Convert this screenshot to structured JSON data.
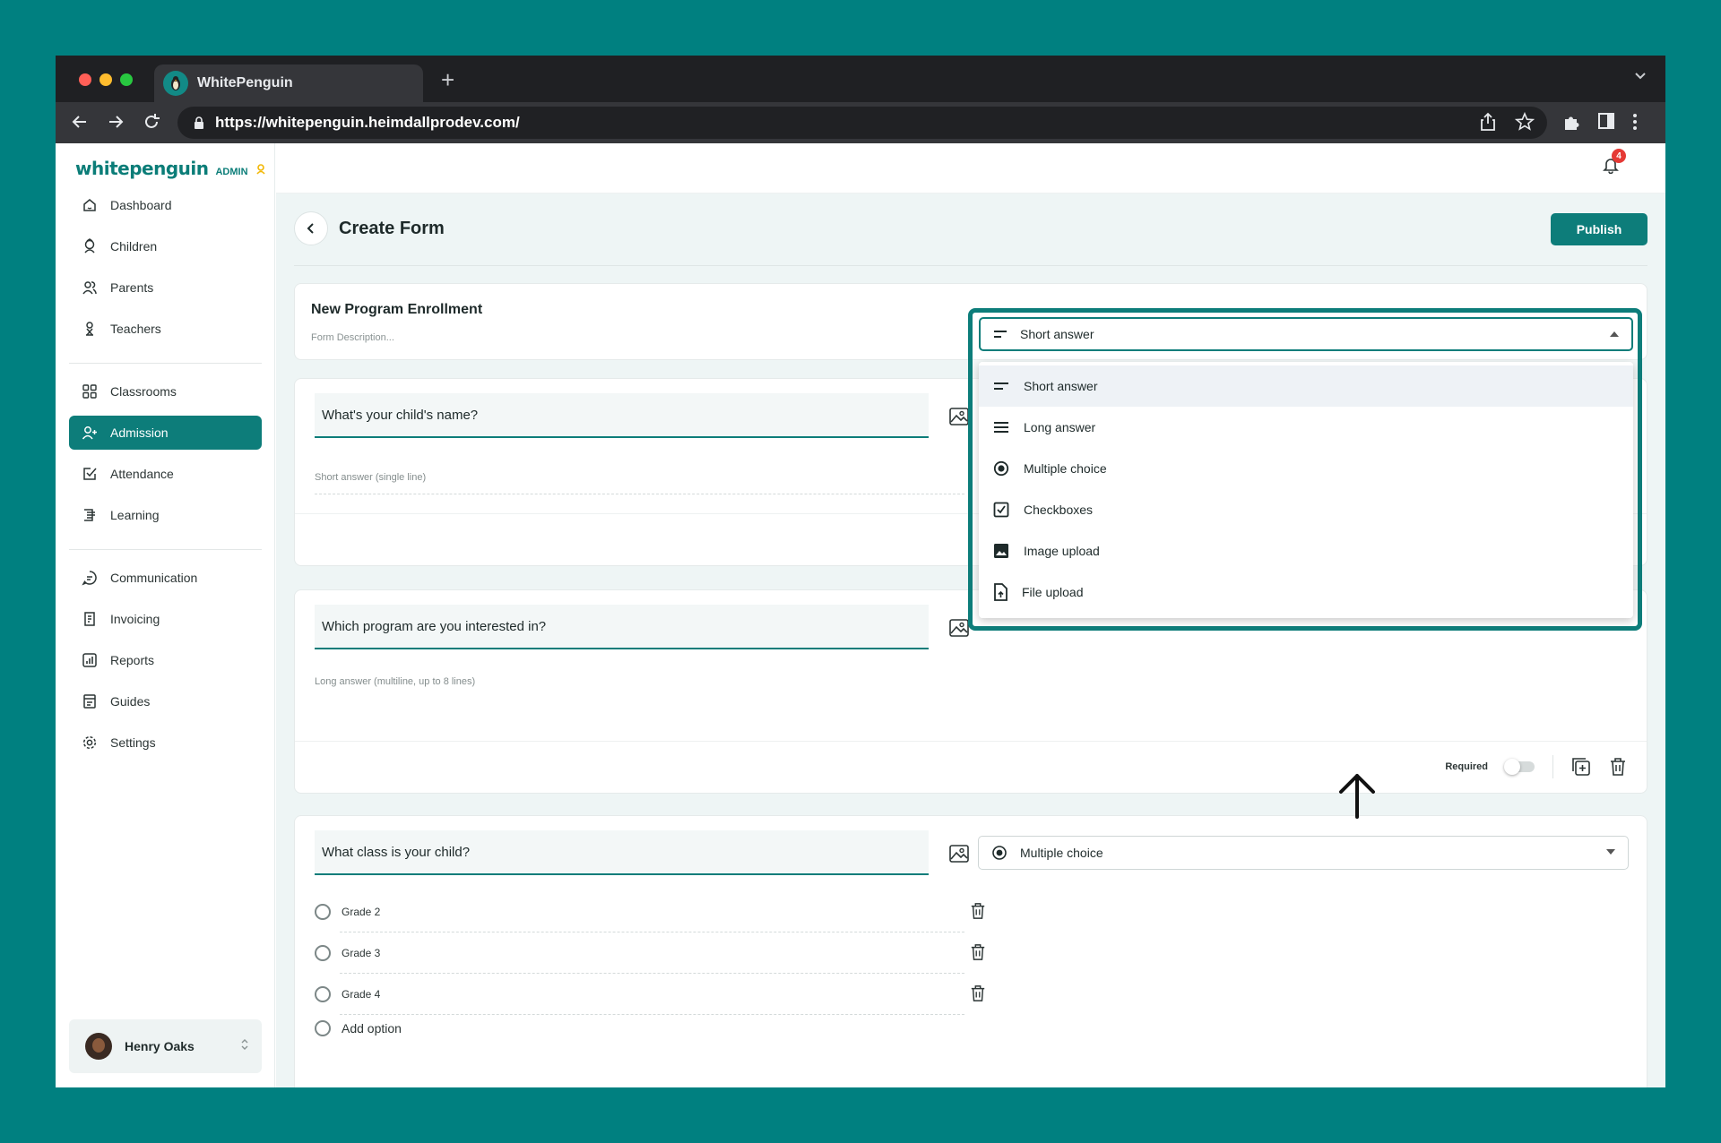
{
  "browser": {
    "tab_title": "WhitePenguin",
    "url": "https://whitepenguin.heimdallprodev.com/"
  },
  "brand": {
    "logo": "whitepenguin",
    "role_badge": "ADMIN"
  },
  "notifications": {
    "count": "4"
  },
  "sidebar": {
    "items": [
      {
        "label": "Dashboard",
        "icon": "home-icon"
      },
      {
        "label": "Children",
        "icon": "child-icon"
      },
      {
        "label": "Parents",
        "icon": "parents-icon"
      },
      {
        "label": "Teachers",
        "icon": "teacher-icon"
      },
      {
        "label": "Classrooms",
        "icon": "grid-icon"
      },
      {
        "label": "Admission",
        "icon": "user-plus-icon",
        "active": true
      },
      {
        "label": "Attendance",
        "icon": "check-square-icon"
      },
      {
        "label": "Learning",
        "icon": "book-icon"
      },
      {
        "label": "Communication",
        "icon": "chat-icon"
      },
      {
        "label": "Invoicing",
        "icon": "invoice-icon"
      },
      {
        "label": "Reports",
        "icon": "chart-icon"
      },
      {
        "label": "Guides",
        "icon": "guide-icon"
      },
      {
        "label": "Settings",
        "icon": "gear-icon"
      }
    ],
    "user": {
      "name": "Henry Oaks"
    }
  },
  "page": {
    "title": "Create Form",
    "publish_label": "Publish"
  },
  "form": {
    "title": "New Program Enrollment",
    "description_placeholder": "Form Description..."
  },
  "questions": [
    {
      "text": "What's your child's name?",
      "hint": "Short answer (single line)",
      "type": "Short answer"
    },
    {
      "text": "Which program are you interested in?",
      "hint": "Long answer (multiline, up to 8 lines)",
      "required_label": "Required"
    },
    {
      "text": "What class is your child?",
      "type": "Multiple choice",
      "options": [
        "Grade 2",
        "Grade 3",
        "Grade 4"
      ],
      "add_option": "Add option"
    }
  ],
  "type_menu": [
    {
      "label": "Short answer",
      "icon": "short-answer-icon",
      "selected": true
    },
    {
      "label": "Long answer",
      "icon": "long-answer-icon"
    },
    {
      "label": "Multiple choice",
      "icon": "radio-icon"
    },
    {
      "label": "Checkboxes",
      "icon": "checkbox-icon"
    },
    {
      "label": "Image upload",
      "icon": "image-icon"
    },
    {
      "label": "File upload",
      "icon": "file-upload-icon"
    }
  ],
  "colors": {
    "background": "#008080",
    "accent": "#0d7d7a",
    "badge": "#e53935"
  }
}
